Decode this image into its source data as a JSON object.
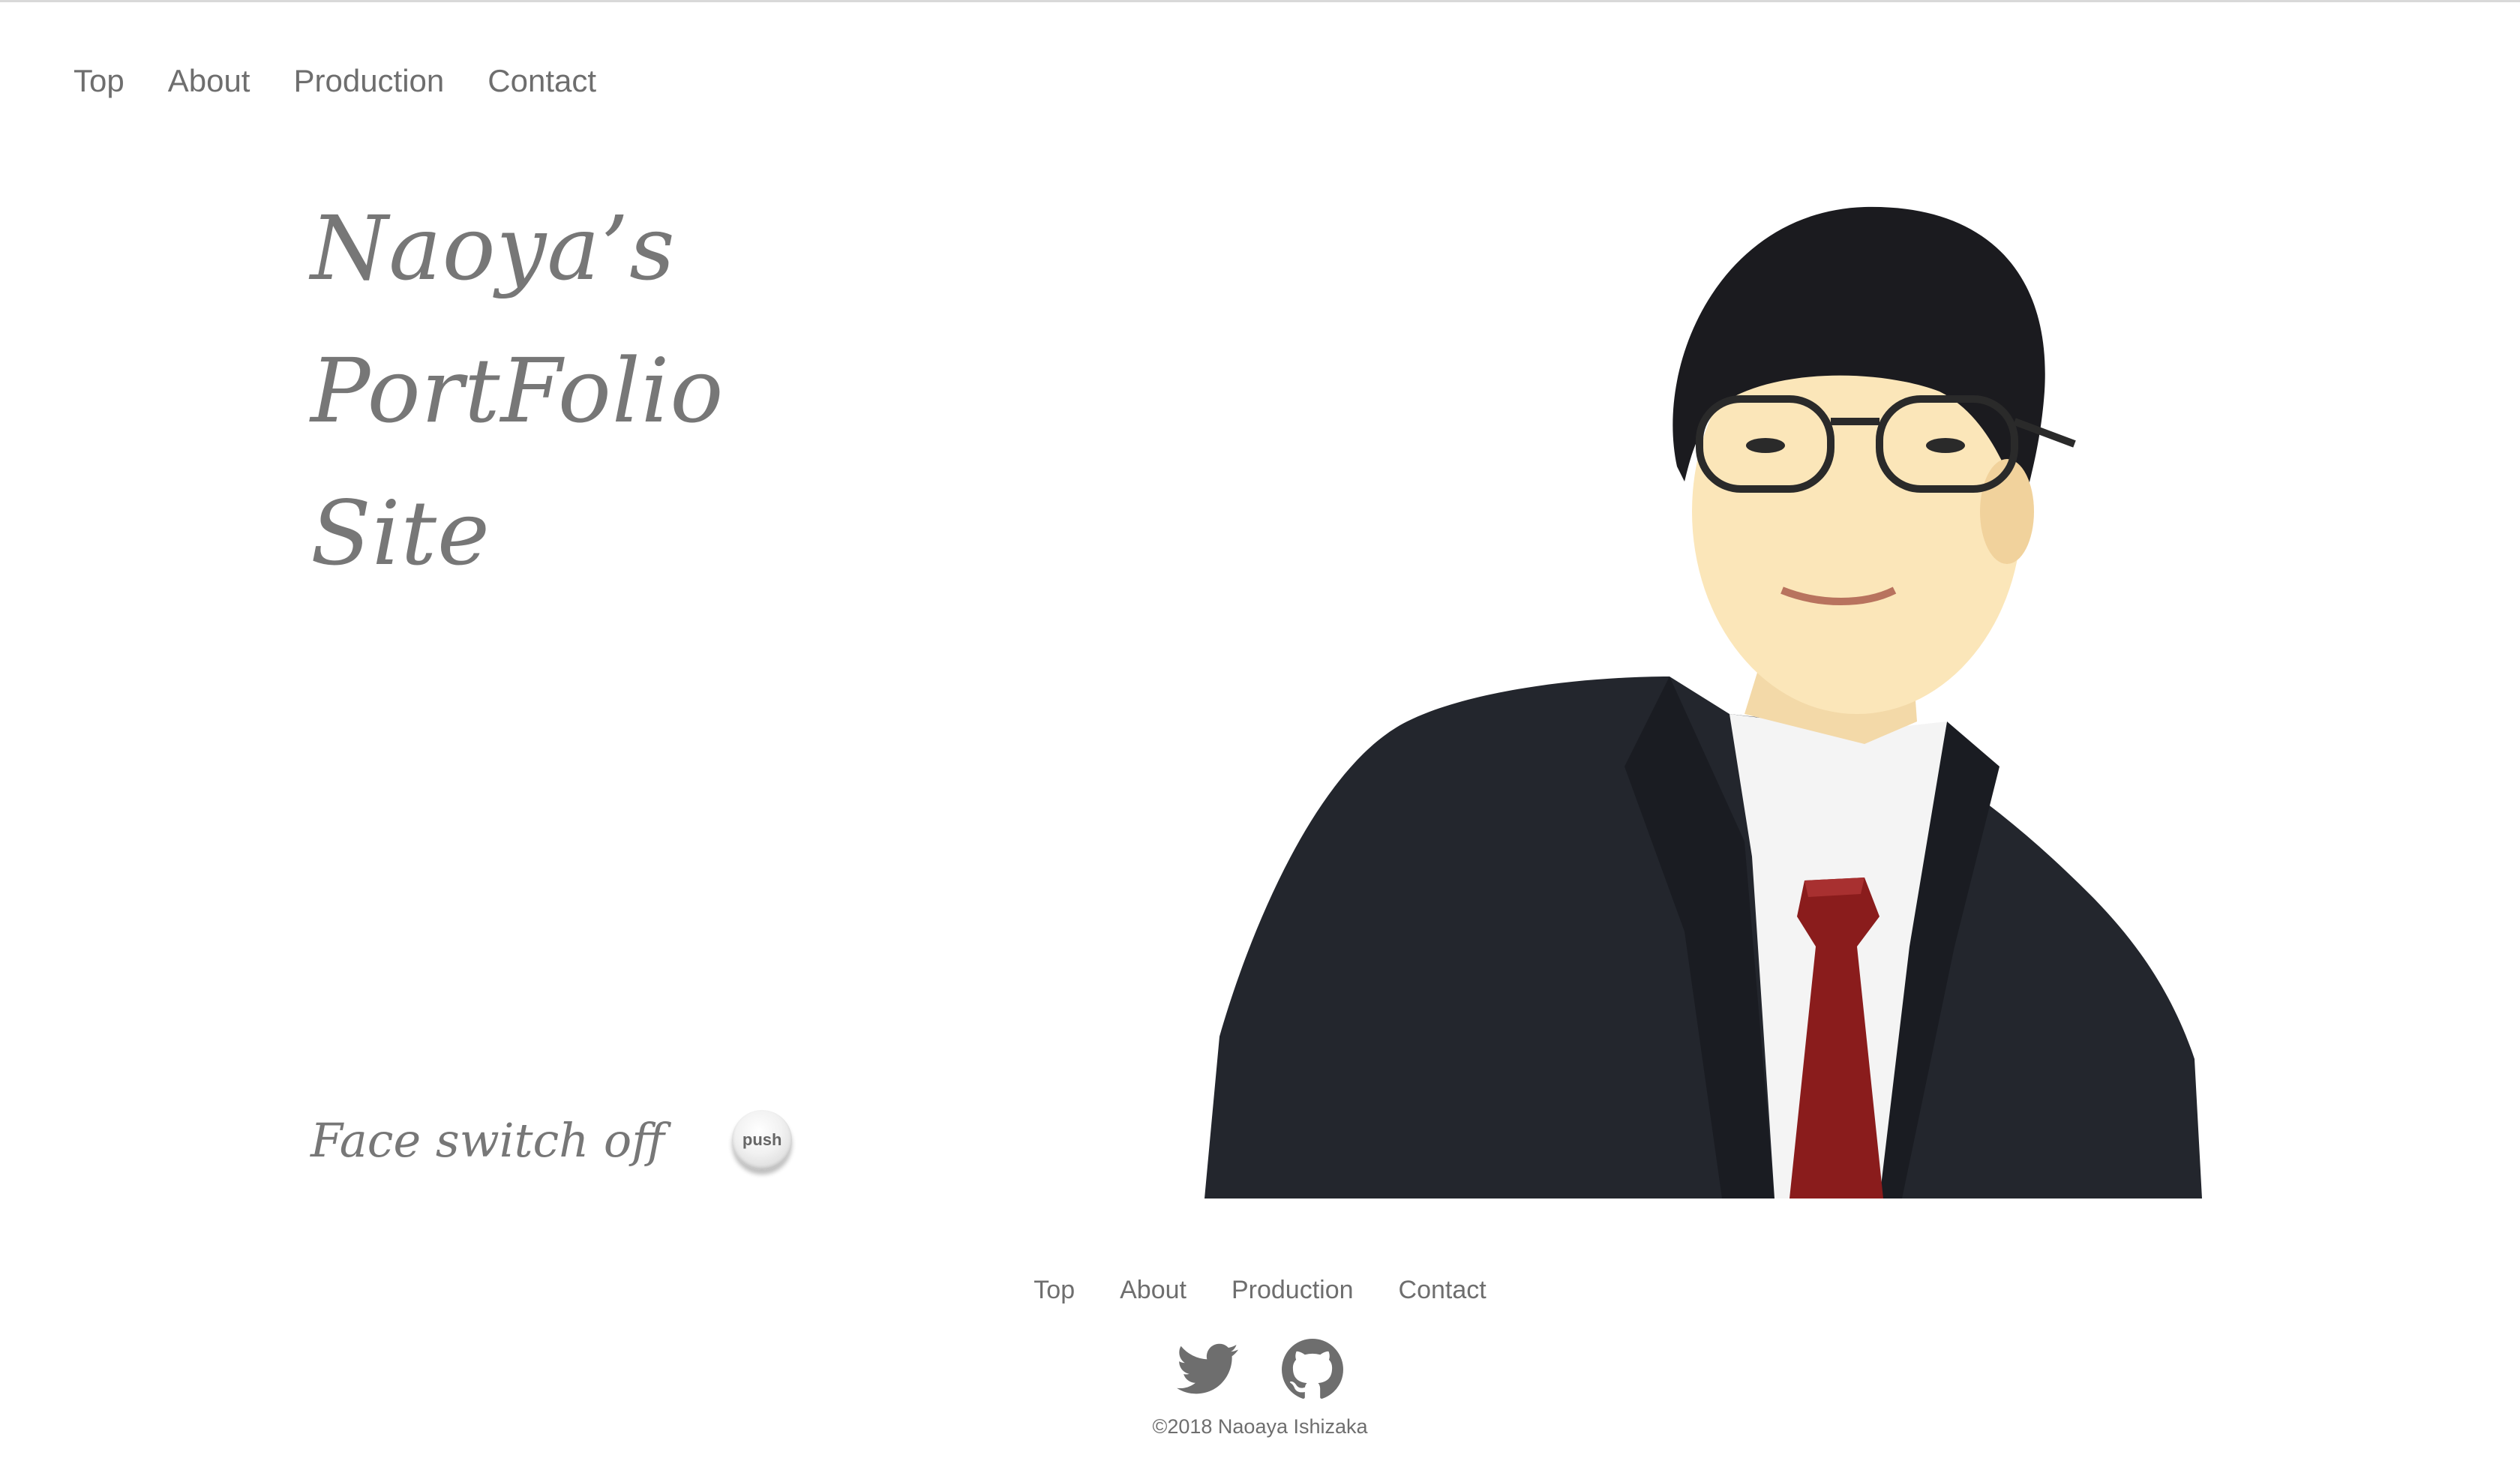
{
  "nav": {
    "items": [
      {
        "label": "Top"
      },
      {
        "label": "About"
      },
      {
        "label": "Production"
      },
      {
        "label": "Contact"
      }
    ]
  },
  "hero": {
    "title_lines": [
      "Naoya’s",
      "PortFolio",
      "Site"
    ],
    "face_switch_label": "Face switch off",
    "push_button_label": "push"
  },
  "footer": {
    "nav": [
      {
        "label": "Top"
      },
      {
        "label": "About"
      },
      {
        "label": "Production"
      },
      {
        "label": "Contact"
      }
    ],
    "social": [
      {
        "icon": "twitter-icon"
      },
      {
        "icon": "github-icon"
      }
    ],
    "copyright": "©2018 Naoaya Ishizaka"
  },
  "colors": {
    "text": "#777777",
    "background": "#ffffff",
    "suit": "#22252b",
    "tie": "#8a1c1c",
    "icon": "#6e6e6e"
  }
}
